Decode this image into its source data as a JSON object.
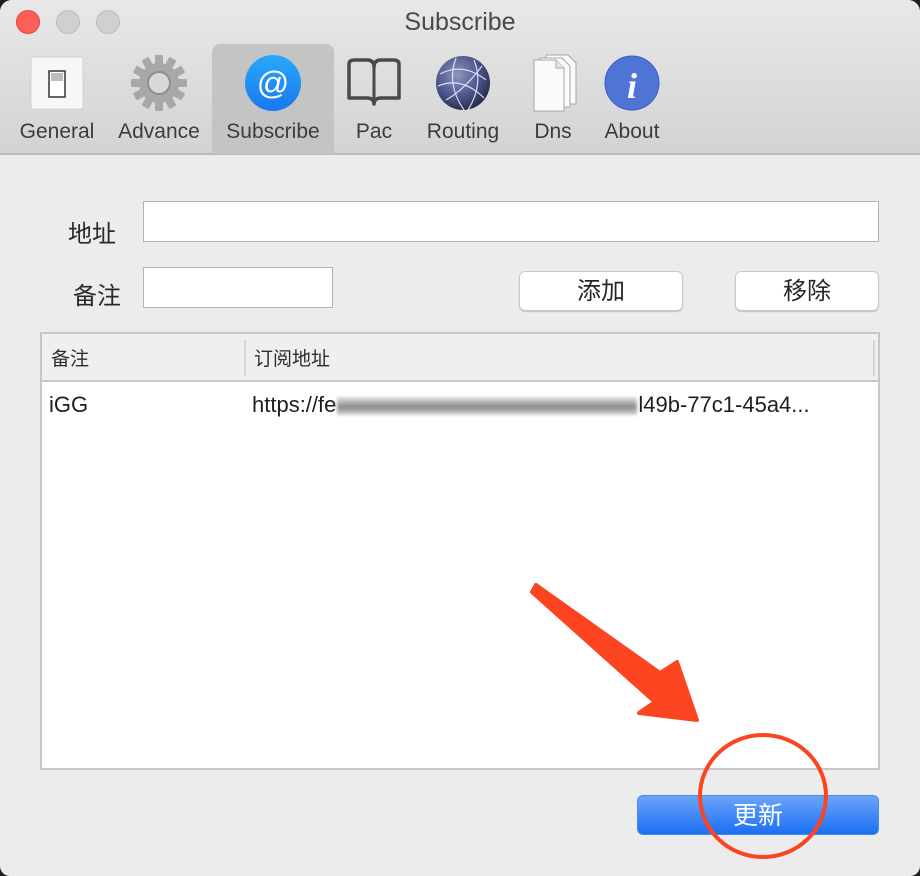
{
  "window": {
    "title": "Subscribe"
  },
  "toolbar": {
    "tabs": [
      {
        "label": "General",
        "icon": "switch-icon",
        "active": false
      },
      {
        "label": "Advance",
        "icon": "gear-icon",
        "active": false
      },
      {
        "label": "Subscribe",
        "icon": "at-sign-icon",
        "active": true
      },
      {
        "label": "Pac",
        "icon": "book-icon",
        "active": false
      },
      {
        "label": "Routing",
        "icon": "globe-icon",
        "active": false
      },
      {
        "label": "Dns",
        "icon": "documents-icon",
        "active": false
      },
      {
        "label": "About",
        "icon": "info-icon",
        "active": false
      }
    ]
  },
  "form": {
    "address_label": "地址",
    "address_value": "",
    "remark_label": "备注",
    "remark_value": "",
    "add_button": "添加",
    "remove_button": "移除"
  },
  "table": {
    "columns": [
      "备注",
      "订阅地址"
    ],
    "rows": [
      {
        "remark": "iGG",
        "url_prefix": "https://fe",
        "url_suffix": "l49b-77c1-45a4..."
      }
    ]
  },
  "footer": {
    "update_button": "更新"
  },
  "colors": {
    "accent_blue": "#1c6ff5",
    "annotation_red": "#fc4420",
    "close_red": "#fc5f57"
  }
}
